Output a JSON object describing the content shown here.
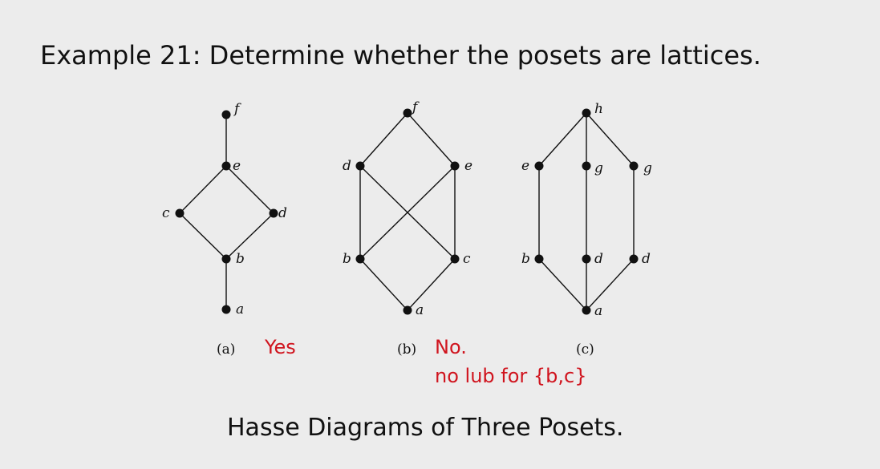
{
  "title": "Example 21: Determine whether the posets are lattices.",
  "footer": "Hasse Diagrams of Three Posets.",
  "colors": {
    "answer": "#d0141e",
    "ink": "#111111",
    "background": "#ececec"
  },
  "diagrams": [
    {
      "id": "a",
      "caption": "(a)",
      "answer": "Yes",
      "answer_note": "",
      "nodes": [
        "a",
        "b",
        "c",
        "d",
        "e",
        "f"
      ],
      "edges": [
        [
          "a",
          "b"
        ],
        [
          "b",
          "c"
        ],
        [
          "b",
          "d"
        ],
        [
          "c",
          "e"
        ],
        [
          "d",
          "e"
        ],
        [
          "e",
          "f"
        ]
      ]
    },
    {
      "id": "b",
      "caption": "(b)",
      "answer": "No.",
      "answer_note": "no lub for {b,c}",
      "nodes": [
        "a",
        "b",
        "c",
        "d",
        "e",
        "f"
      ],
      "edges": [
        [
          "a",
          "b"
        ],
        [
          "a",
          "c"
        ],
        [
          "b",
          "d"
        ],
        [
          "b",
          "e"
        ],
        [
          "c",
          "d"
        ],
        [
          "c",
          "e"
        ],
        [
          "d",
          "f"
        ],
        [
          "e",
          "f"
        ]
      ]
    },
    {
      "id": "c",
      "caption": "(c)",
      "answer": "",
      "answer_note": "",
      "nodes": [
        "a",
        "b",
        "d",
        "d2",
        "e",
        "g",
        "g2",
        "h"
      ],
      "labels": {
        "a": "a",
        "b": "b",
        "d": "d",
        "d2": "d",
        "e": "e",
        "g": "g",
        "g2": "g",
        "h": "h"
      },
      "edges": [
        [
          "a",
          "b"
        ],
        [
          "a",
          "d"
        ],
        [
          "a",
          "d2"
        ],
        [
          "b",
          "e"
        ],
        [
          "d",
          "g"
        ],
        [
          "d2",
          "g2"
        ],
        [
          "e",
          "h"
        ],
        [
          "g",
          "h"
        ],
        [
          "g2",
          "h"
        ]
      ]
    }
  ]
}
